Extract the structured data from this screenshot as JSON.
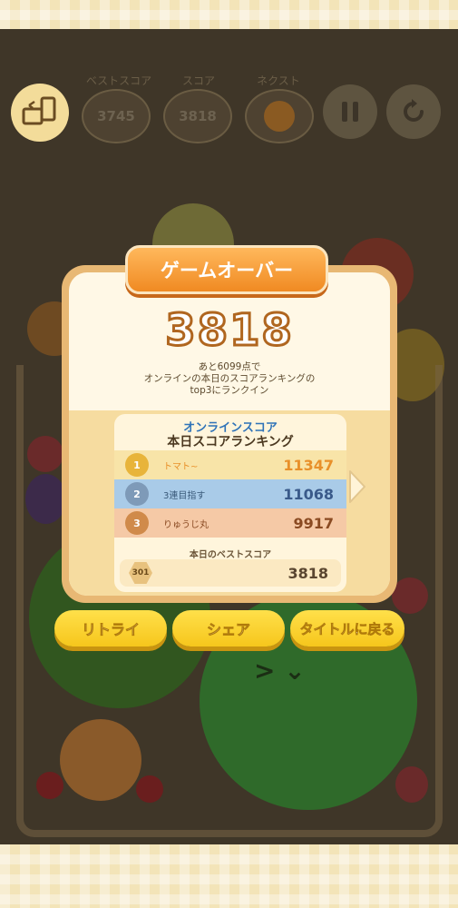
{
  "hud": {
    "best_label": "ベストスコア",
    "best_value": "3745",
    "score_label": "スコア",
    "score_value": "3818",
    "next_label": "ネクスト"
  },
  "dialog": {
    "title": "ゲームオーバー",
    "score": "3818",
    "message_line1": "あと6099点で",
    "message_line2": "オンラインの本日のスコアランキングの",
    "message_line3": "top3にランクイン"
  },
  "ranking": {
    "heading_online": "オンラインスコア",
    "heading_today": "本日スコアランキング",
    "rows": [
      {
        "rank": "1",
        "name": "トマト~",
        "score": "11347"
      },
      {
        "rank": "2",
        "name": "3連目指す",
        "score": "11068"
      },
      {
        "rank": "3",
        "name": "りゅうじ丸",
        "score": "9917"
      }
    ],
    "best_label": "本日のベストスコア",
    "best_rank": "301",
    "best_score": "3818"
  },
  "buttons": {
    "retry": "リトライ",
    "share": "シェア",
    "title": "タイトルに戻る"
  },
  "colors": {
    "accent_orange": "#f08a22",
    "button_yellow": "#f6c61c",
    "rank1": "#f8e4a8",
    "rank2": "#a9cbe8",
    "rank3": "#f5c9a6"
  }
}
